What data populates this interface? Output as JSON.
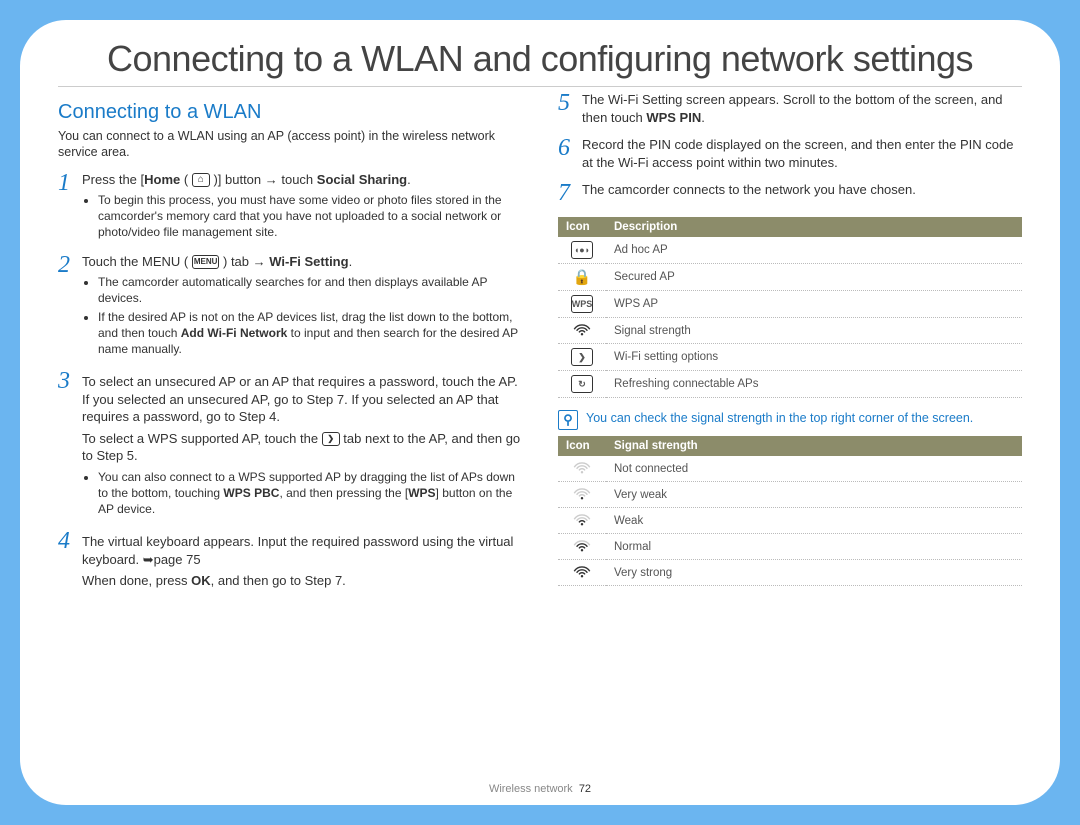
{
  "doc_title": "Connecting to a WLAN and configuring network settings",
  "section_title": "Connecting to a WLAN",
  "intro": "You can connect to a WLAN using an AP (access point) in the wireless network service area.",
  "steps": {
    "s1": {
      "main_a": "Press the [",
      "main_b": "Home",
      "main_c": " ( ",
      "main_d": " )] button → touch ",
      "main_e": "Social Sharing",
      "main_f": ".",
      "bullets": [
        "To begin this process, you must have some video or photo files stored in the camcorder's memory card that you have not uploaded to a social network or photo/video file management site."
      ]
    },
    "s2": {
      "main_a": "Touch the MENU ( ",
      "main_b": " ) tab → ",
      "main_c": "Wi-Fi Setting",
      "main_d": ".",
      "bullets": [
        "The camcorder automatically searches for and then displays available AP devices.",
        "If the desired AP is not on the AP devices list, drag the list down to the bottom, and then touch <b>Add Wi-Fi Network</b> to input and then search for the desired AP name manually."
      ]
    },
    "s3": {
      "para1": "To select an unsecured AP or an AP that requires a password, touch the AP. If you selected an unsecured AP, go to Step 7. If you selected an AP that requires a password, go to Step 4.",
      "para2_a": "To select a WPS supported AP, touch the ",
      "para2_b": " tab next to the AP, and then go to Step 5.",
      "bullets": [
        "You can also connect to a WPS supported AP by dragging the list of APs down to the bottom, touching <b>WPS PBC</b>, and then pressing the [<b>WPS</b>] button on the AP device."
      ]
    },
    "s4": {
      "para1": "The virtual keyboard appears. Input the required password using the virtual keyboard. ➥page 75",
      "para2_a": "When done, press ",
      "para2_b": "OK",
      "para2_c": ", and then go to Step 7."
    },
    "s5": {
      "para_a": "The Wi-Fi Setting screen appears. Scroll to the bottom of the screen, and then touch ",
      "para_b": "WPS PIN",
      "para_c": "."
    },
    "s6": {
      "para": "Record the PIN code displayed on the screen, and then enter the PIN code at the Wi-Fi access point within two minutes."
    },
    "s7": {
      "para": "The camcorder connects to the network you have chosen."
    }
  },
  "table1": {
    "headers": [
      "Icon",
      "Description"
    ],
    "rows": [
      {
        "icon": "adhoc",
        "desc": "Ad hoc AP"
      },
      {
        "icon": "lock",
        "desc": "Secured AP"
      },
      {
        "icon": "wps",
        "desc": "WPS AP"
      },
      {
        "icon": "wifi4",
        "desc": "Signal strength"
      },
      {
        "icon": "arrow",
        "desc": "Wi-Fi setting options"
      },
      {
        "icon": "refresh",
        "desc": "Refreshing connectable APs"
      }
    ]
  },
  "note": "You can check the signal strength in the top right corner of the screen.",
  "table2": {
    "headers": [
      "Icon",
      "Signal strength"
    ],
    "rows": [
      {
        "icon": "wifi0",
        "desc": "Not connected"
      },
      {
        "icon": "wifi1",
        "desc": "Very weak"
      },
      {
        "icon": "wifi2",
        "desc": "Weak"
      },
      {
        "icon": "wifi3",
        "desc": "Normal"
      },
      {
        "icon": "wifi4",
        "desc": "Very strong"
      }
    ]
  },
  "footer_label": "Wireless network",
  "page_number": "72",
  "icons": {
    "home_glyph": "⌂",
    "menu_glyph": "MENU",
    "arrow_glyph": "❯",
    "adhoc_glyph": "📶",
    "lock_glyph": "🔒",
    "wps_glyph": "WPS",
    "refresh_glyph": "↻",
    "mag_glyph": "⚲"
  }
}
